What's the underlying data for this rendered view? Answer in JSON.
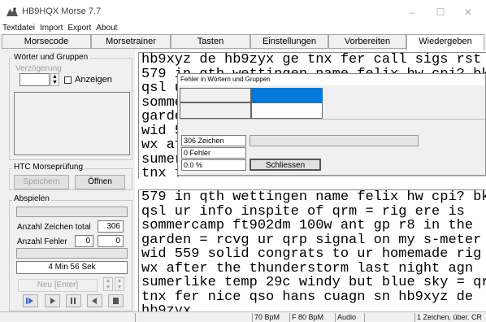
{
  "window": {
    "title": "HB9HQX Morse 7.7",
    "min_glyph": "–",
    "max_glyph": "☐",
    "close_glyph": "✕"
  },
  "menu": [
    "Textdatei",
    "Import",
    "Export",
    "About"
  ],
  "tabs": [
    "Morsecode",
    "Morsetrainer",
    "Tasten",
    "Einstellungen",
    "Vorbereiten",
    "Wiedergeben"
  ],
  "active_tab": "Wiedergeben",
  "left": {
    "group1_label": "Wörter und Gruppen",
    "verzoegerung_label": "Verzögerung",
    "verzoegerung_value": "",
    "anzeigen_label": "Anzeigen",
    "htc_label": "HTC Morseprüfung",
    "speichern_label": "Speichern",
    "oeffnen_label": "Öffnen",
    "abspielen_label": "Abspielen",
    "anzahl_zeichen_label": "Anzahl Zeichen total",
    "anzahl_zeichen_value": "306",
    "anzahl_fehler_label": "Anzahl Fehler",
    "anzahl_fehler_value1": "0",
    "anzahl_fehler_value2": "0",
    "duration": "4 Min 56 Sek",
    "neu_label": "Neu  [Enter]"
  },
  "top_text": [
    "hb9xyz de hb9zyx ge tnx fer call sigs rst",
    "579 in qth wettingen name felix hw cpi? bk",
    "qsl u",
    "somme",
    "garde",
    "wid 5",
    "wx af",
    "sumer",
    "tnx f"
  ],
  "bottom_text": [
    "579 in qth wettingen name felix hw cpi? bk =",
    "qsl ur info inspite of qrm = rig ere is",
    "sommercamp ft902dm 100w ant gp r8 in the",
    "garden = rcvg ur qrp signal on my s-meter",
    "wid 559 solid congrats to ur homemade rig =",
    "wx after the thunderstorm last night agn",
    "sumerlike temp 29c windy but blue sky = qru",
    "tnx fer nice qso hans cuagn sn hb9xyz de",
    "hb9zyx"
  ],
  "dialog": {
    "title": "Fehler in Wörtern und Gruppen",
    "zeichen": "306 Zeichen",
    "fehler": "0 Fehler",
    "prozent": "0.0 %",
    "close_label": "Schliessen",
    "highlight_color": "#0078d7"
  },
  "status": {
    "bpm": "70 BpM",
    "fbpm": "F 80 BpM",
    "audio": "Audio",
    "zeichen": "1 Zeichen, über. CR"
  }
}
